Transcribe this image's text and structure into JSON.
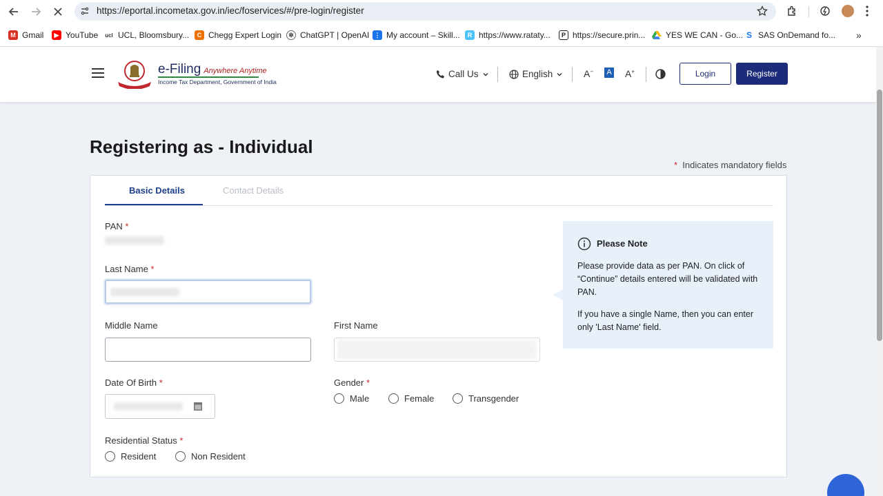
{
  "browser": {
    "url": "https://eportal.incometax.gov.in/iec/foservices/#/pre-login/register",
    "bookmarks": [
      {
        "label": "Gmail",
        "icon": "gmail-icon",
        "color": "#d93025"
      },
      {
        "label": "YouTube",
        "icon": "youtube-icon",
        "color": "#ff0000"
      },
      {
        "label": "UCL, Bloomsbury...",
        "icon": "ucl-icon",
        "color": "#555555"
      },
      {
        "label": "Chegg Expert Login",
        "icon": "chegg-icon",
        "color": "#eb7100"
      },
      {
        "label": "ChatGPT | OpenAI",
        "icon": "chatgpt-icon",
        "color": "#333333"
      },
      {
        "label": "My account – Skill...",
        "icon": "skill-icon",
        "color": "#1a73e8"
      },
      {
        "label": "https://www.rataty...",
        "icon": "ratatype-icon",
        "color": "#4fc3f7"
      },
      {
        "label": "https://secure.prin...",
        "icon": "prin-icon",
        "color": "#222222"
      },
      {
        "label": "YES WE CAN - Go...",
        "icon": "drive-icon",
        "color": "#34a853"
      },
      {
        "label": "SAS OnDemand fo...",
        "icon": "sas-icon",
        "color": "#1a73e8"
      }
    ]
  },
  "header": {
    "logo_title": "e-Filing",
    "logo_tagline": "Anywhere Anytime",
    "logo_subtitle": "Income Tax Department, Government of India",
    "call_us": "Call Us",
    "language": "English",
    "font_decrease": "A",
    "font_normal": "A",
    "font_increase": "A",
    "login": "Login",
    "register": "Register"
  },
  "page": {
    "title": "Registering as -  Individual",
    "mandatory_note": "Indicates mandatory fields",
    "tabs": [
      {
        "label": "Basic Details",
        "active": true
      },
      {
        "label": "Contact Details",
        "active": false
      }
    ]
  },
  "form": {
    "pan_label": "PAN",
    "last_name_label": "Last Name",
    "middle_name_label": "Middle Name",
    "first_name_label": "First Name",
    "dob_label": "Date Of Birth",
    "gender_label": "Gender",
    "gender_options": [
      "Male",
      "Female",
      "Transgender"
    ],
    "residential_label": "Residential Status",
    "residential_options": [
      "Resident",
      "Non Resident"
    ]
  },
  "note": {
    "title": "Please Note",
    "para1": "Please provide data as per PAN. On click of “Continue” details entered will be validated with PAN.",
    "para2": "If you have a single Name, then you can enter only 'Last Name' field."
  },
  "colors": {
    "primary": "#1d2c7a",
    "required": "#c62828",
    "note_bg": "#e8f1fa"
  }
}
